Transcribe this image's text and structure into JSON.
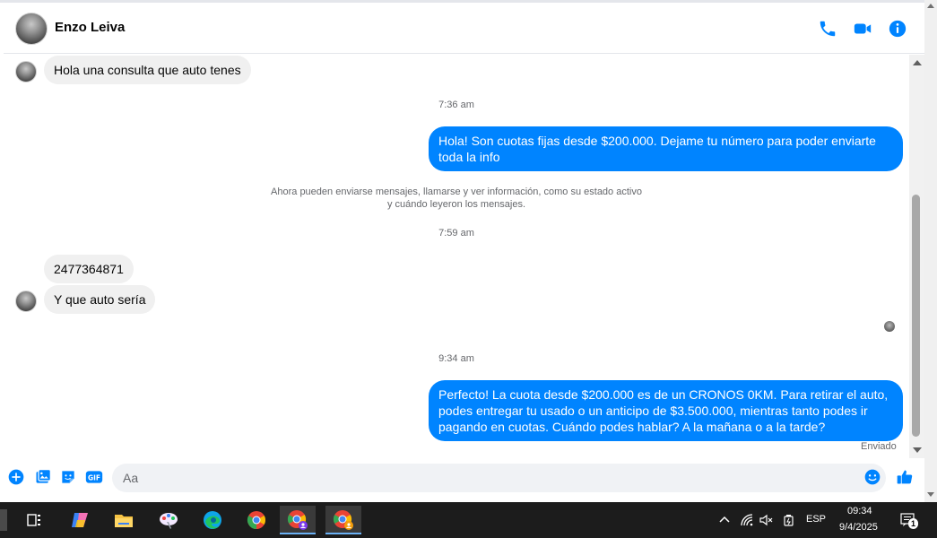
{
  "contact": {
    "name": "Enzo Leiva"
  },
  "header_icons": [
    "phone-icon",
    "video-camera-icon",
    "info-icon"
  ],
  "messages": {
    "in_1": "Hola una consulta que auto tenes",
    "ts_1": "7:36 am",
    "out_1": "Hola! Son cuotas fijas desde $200.000. Dejame tu número para poder enviarte toda la info",
    "notice_line1": "Ahora pueden enviarse mensajes, llamarse y ver información, como su estado activo",
    "notice_line2": "y cuándo leyeron los mensajes.",
    "ts_2": "7:59 am",
    "in_2": "2477364871",
    "in_3": "Y que auto sería",
    "ts_3": "9:34 am",
    "out_2": "Perfecto! La cuota desde $200.000 es de un CRONOS 0KM. Para retirar el auto, podes entregar tu usado o un anticipo de $3.500.000, mientras tanto podes ir pagando en cuotas. Cuándo podes hablar? A la mañana o a la tarde?",
    "status": "Enviado"
  },
  "composer": {
    "placeholder": "Aa",
    "value": "",
    "icons": [
      "plus-icon",
      "image-icon",
      "sticker-icon",
      "gif-icon",
      "emoji-icon",
      "thumbs-up-icon"
    ],
    "gif_label": "GIF"
  },
  "taskbar": {
    "apps": [
      "task-view",
      "copilot",
      "file-explorer",
      "paint",
      "edge",
      "chrome",
      "chrome-profile-1",
      "chrome-profile-2"
    ],
    "language": "ESP",
    "time": "09:34",
    "date": "9/4/2025",
    "notification_count": "1"
  },
  "colors": {
    "accent": "#0084ff",
    "incoming_bubble": "#f0f0f0",
    "taskbar": "#1c1c1c"
  }
}
